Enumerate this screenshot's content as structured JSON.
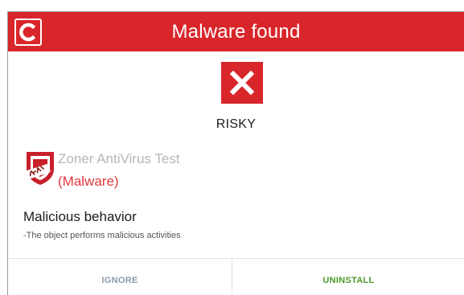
{
  "header": {
    "title": "Malware found",
    "logo_icon": "comodo-c-logo-icon",
    "color": "#d9262b"
  },
  "status": {
    "icon": "close-x-icon",
    "label": "RISKY"
  },
  "threat": {
    "app_icon": "zoner-antivirus-test-shield-icon",
    "app_name": "Zoner AntiVirus Test",
    "verdict": "(Malware)",
    "verdict_color": "#e03a3e"
  },
  "behavior": {
    "title": "Malicious behavior",
    "description": "-The object performs malicious activities"
  },
  "actions": {
    "ignore_label": "IGNORE",
    "uninstall_label": "UNINSTALL",
    "uninstall_color": "#4c9a2a"
  }
}
